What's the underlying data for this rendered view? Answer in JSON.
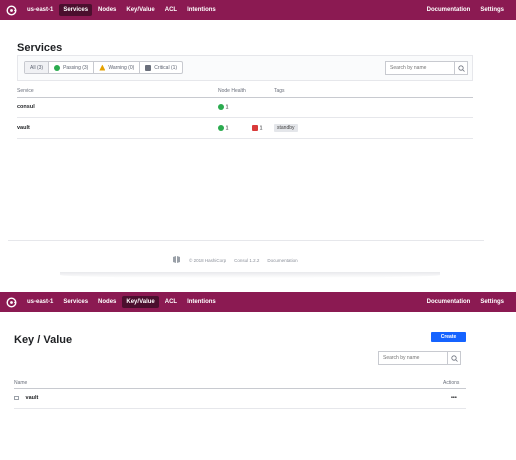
{
  "services_screen": {
    "nav": {
      "datacenter": "us-east-1",
      "items": [
        "Services",
        "Nodes",
        "Key/Value",
        "ACL",
        "Intentions"
      ],
      "right": [
        "Documentation",
        "Settings"
      ]
    },
    "title": "Services",
    "filters": {
      "all": "All (3)",
      "passing": "Passing (3)",
      "warning": "Warning (0)",
      "critical": "Critical (1)"
    },
    "search": {
      "placeholder": "Search by name"
    },
    "columns": {
      "service": "Service",
      "node_health": "Node Health",
      "tags": "Tags"
    },
    "rows": [
      {
        "name": "consul",
        "passing": "1",
        "critical": "",
        "tag": ""
      },
      {
        "name": "vault",
        "passing": "1",
        "critical": "1",
        "tag": "standby"
      }
    ],
    "footer": {
      "copyright": "© 2018 HashiCorp",
      "version": "Consul 1.2.2",
      "docs": "Documentation"
    }
  },
  "kv_screen": {
    "nav": {
      "datacenter": "us-east-1",
      "items": [
        "Services",
        "Nodes",
        "Key/Value",
        "ACL",
        "Intentions"
      ],
      "right": [
        "Documentation",
        "Settings"
      ]
    },
    "title": "Key / Value",
    "create_label": "Create",
    "search": {
      "placeholder": "Search by name"
    },
    "columns": {
      "name": "Name",
      "actions": "Actions"
    },
    "rows": [
      {
        "name": "vault",
        "actions": "•••"
      }
    ]
  },
  "colors": {
    "nav_bg": "#8b1a52",
    "nav_active": "#4b0f2e",
    "passing": "#2bab4f",
    "critical": "#d93a3a",
    "create": "#1563ff"
  }
}
